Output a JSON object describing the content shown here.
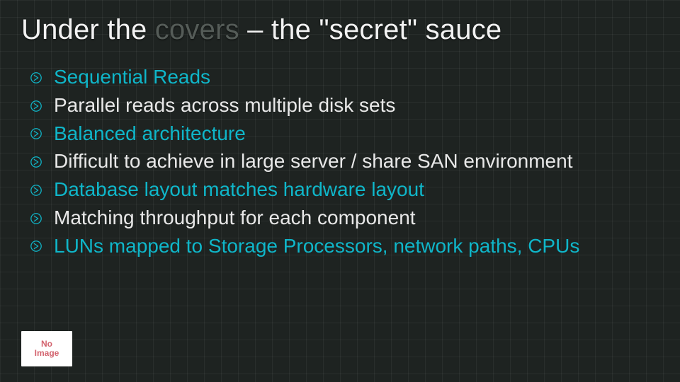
{
  "title": {
    "part1": "Under the ",
    "part2": "covers",
    "part3": " – the \"secret\" sauce"
  },
  "bullets": [
    {
      "text": "Sequential Reads",
      "color": "teal"
    },
    {
      "text": "Parallel reads across multiple disk sets",
      "color": "white"
    },
    {
      "text": "Balanced architecture",
      "color": "teal"
    },
    {
      "text": "Difficult to achieve in large server / share SAN environment",
      "color": "white"
    },
    {
      "text": "Database layout matches hardware layout",
      "color": "teal"
    },
    {
      "text": "Matching throughput for each component",
      "color": "white"
    },
    {
      "text": "LUNs mapped to Storage Processors, network paths, CPUs",
      "color": "teal"
    }
  ],
  "placeholder": {
    "line1": "No",
    "line2": "Image"
  }
}
